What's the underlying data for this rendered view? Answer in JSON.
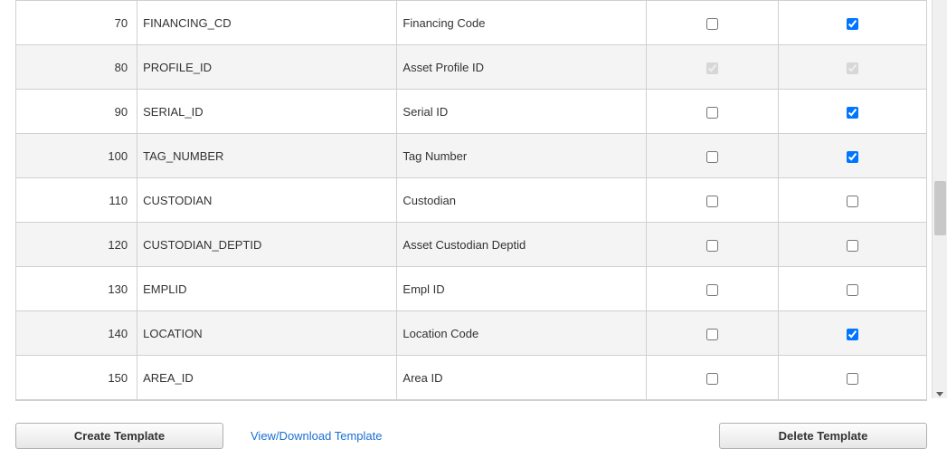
{
  "table": {
    "rows": [
      {
        "num": "70",
        "field": "FINANCING_CD",
        "desc": "Financing Code",
        "chk1": false,
        "chk1_disabled": false,
        "chk2": true,
        "chk2_disabled": false
      },
      {
        "num": "80",
        "field": "PROFILE_ID",
        "desc": "Asset Profile ID",
        "chk1": true,
        "chk1_disabled": true,
        "chk2": true,
        "chk2_disabled": true
      },
      {
        "num": "90",
        "field": "SERIAL_ID",
        "desc": "Serial ID",
        "chk1": false,
        "chk1_disabled": false,
        "chk2": true,
        "chk2_disabled": false
      },
      {
        "num": "100",
        "field": "TAG_NUMBER",
        "desc": "Tag Number",
        "chk1": false,
        "chk1_disabled": false,
        "chk2": true,
        "chk2_disabled": false
      },
      {
        "num": "110",
        "field": "CUSTODIAN",
        "desc": "Custodian",
        "chk1": false,
        "chk1_disabled": false,
        "chk2": false,
        "chk2_disabled": false
      },
      {
        "num": "120",
        "field": "CUSTODIAN_DEPTID",
        "desc": "Asset Custodian Deptid",
        "chk1": false,
        "chk1_disabled": false,
        "chk2": false,
        "chk2_disabled": false
      },
      {
        "num": "130",
        "field": "EMPLID",
        "desc": "Empl ID",
        "chk1": false,
        "chk1_disabled": false,
        "chk2": false,
        "chk2_disabled": false
      },
      {
        "num": "140",
        "field": "LOCATION",
        "desc": "Location Code",
        "chk1": false,
        "chk1_disabled": false,
        "chk2": true,
        "chk2_disabled": false
      },
      {
        "num": "150",
        "field": "AREA_ID",
        "desc": "Area ID",
        "chk1": false,
        "chk1_disabled": false,
        "chk2": false,
        "chk2_disabled": false
      }
    ]
  },
  "buttons": {
    "create": "Create Template",
    "delete": "Delete Template"
  },
  "links": {
    "view_download": "View/Download Template"
  }
}
